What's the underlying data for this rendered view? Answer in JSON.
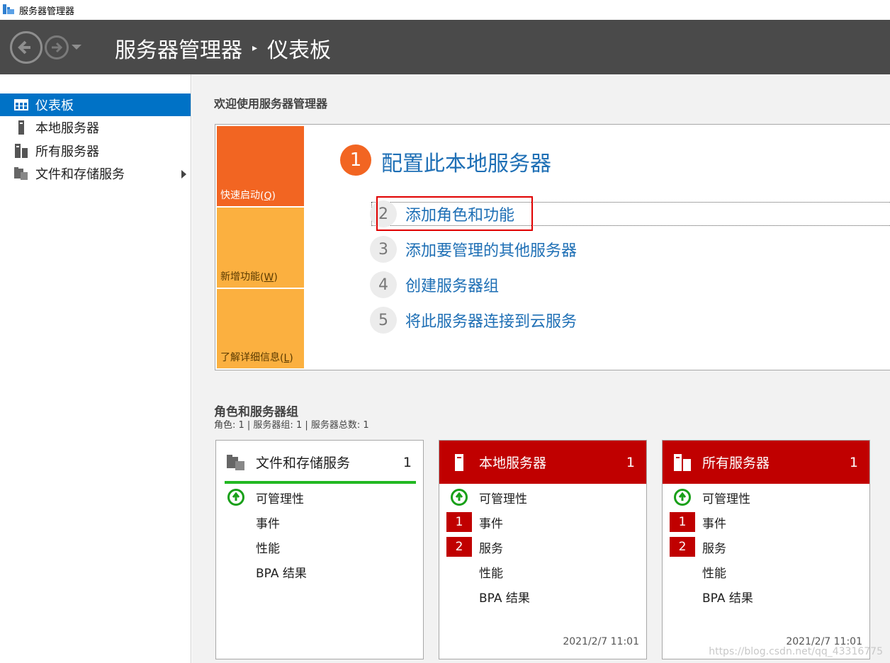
{
  "window": {
    "title": "服务器管理器"
  },
  "header": {
    "crumb_root": "服务器管理器",
    "crumb_separator": "▸",
    "crumb_current": "仪表板"
  },
  "sidebar": {
    "items": [
      {
        "label": "仪表板",
        "icon": "dashboard-icon",
        "active": true
      },
      {
        "label": "本地服务器",
        "icon": "server-icon"
      },
      {
        "label": "所有服务器",
        "icon": "servers-icon"
      },
      {
        "label": "文件和存储服务",
        "icon": "file-storage-icon",
        "has_submenu": true
      }
    ]
  },
  "welcome": {
    "title": "欢迎使用服务器管理器",
    "tiles": [
      {
        "label": "快速启动",
        "key": "Q"
      },
      {
        "label": "新增功能",
        "key": "W"
      },
      {
        "label": "了解详细信息",
        "key": "L"
      }
    ],
    "step1": {
      "num": "1",
      "label": "配置此本地服务器"
    },
    "steps": [
      {
        "num": "2",
        "label": "添加角色和功能"
      },
      {
        "num": "3",
        "label": "添加要管理的其他服务器"
      },
      {
        "num": "4",
        "label": "创建服务器组"
      },
      {
        "num": "5",
        "label": "将此服务器连接到云服务"
      }
    ]
  },
  "roles": {
    "title": "角色和服务器组",
    "summary": "角色: 1 | 服务器组: 1 | 服务器总数: 1",
    "cards": [
      {
        "name": "文件和存储服务",
        "count": "1",
        "status": "ok",
        "rows": [
          {
            "label": "可管理性",
            "indicator": "ok"
          },
          {
            "label": "事件"
          },
          {
            "label": "性能"
          },
          {
            "label": "BPA 结果"
          }
        ]
      },
      {
        "name": "本地服务器",
        "count": "1",
        "status": "alert",
        "rows": [
          {
            "label": "可管理性",
            "indicator": "ok"
          },
          {
            "label": "事件",
            "badge": "1"
          },
          {
            "label": "服务",
            "badge": "2"
          },
          {
            "label": "性能"
          },
          {
            "label": "BPA 结果"
          }
        ],
        "timestamp": "2021/2/7 11:01"
      },
      {
        "name": "所有服务器",
        "count": "1",
        "status": "alert",
        "rows": [
          {
            "label": "可管理性",
            "indicator": "ok"
          },
          {
            "label": "事件",
            "badge": "1"
          },
          {
            "label": "服务",
            "badge": "2"
          },
          {
            "label": "性能"
          },
          {
            "label": "BPA 结果"
          }
        ],
        "timestamp": "2021/2/7 11:01"
      }
    ]
  },
  "watermark": "https://blog.csdn.net/qq_43316775",
  "colors": {
    "accent": "#0072c6",
    "header": "#4a4a4a",
    "orange": "#f26522",
    "yellow": "#fbb040",
    "alert": "#c00000",
    "ok": "#19a019",
    "link": "#1e6fb5"
  }
}
